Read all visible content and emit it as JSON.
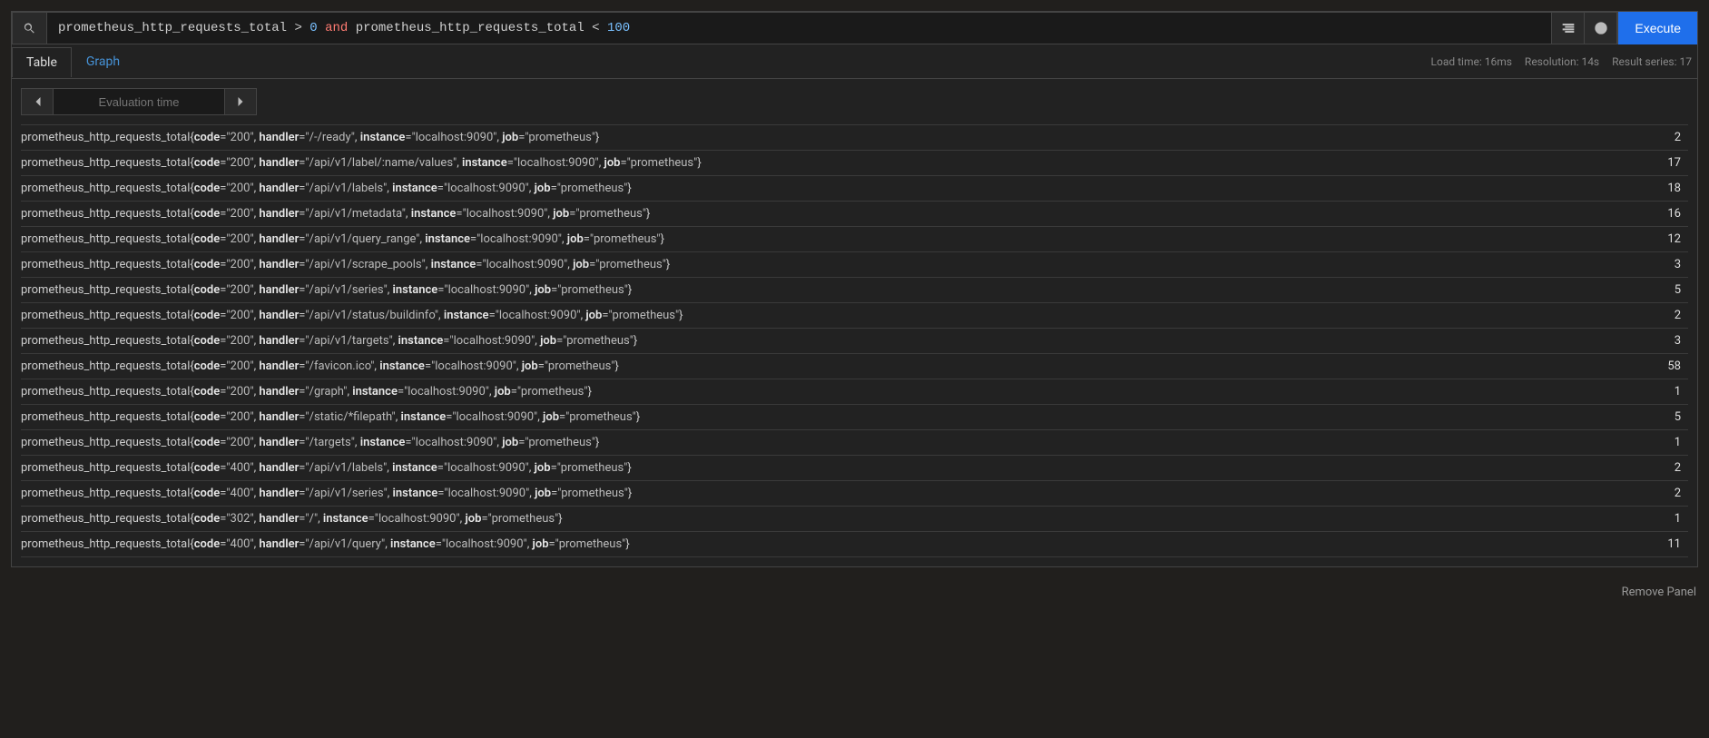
{
  "query": {
    "seg1": "prometheus_http_requests_total",
    "seg2": " > ",
    "seg3": "0",
    "seg4": " and ",
    "seg5": "prometheus_http_requests_total",
    "seg6": " < ",
    "seg7": "100"
  },
  "execute_label": "Execute",
  "tabs": {
    "table": "Table",
    "graph": "Graph"
  },
  "stats": {
    "load": "Load time: 16ms",
    "res": "Resolution: 14s",
    "series": "Result series: 17"
  },
  "eval_placeholder": "Evaluation time",
  "remove": "Remove Panel",
  "metric": "prometheus_http_requests_total",
  "labels": {
    "code": "code",
    "handler": "handler",
    "instance": "instance",
    "job": "job"
  },
  "instance_val": "localhost:9090",
  "job_val": "prometheus",
  "chart_data": {
    "type": "table",
    "rows": [
      {
        "code": "200",
        "handler": "/-/ready",
        "value": "2"
      },
      {
        "code": "200",
        "handler": "/api/v1/label/:name/values",
        "value": "17"
      },
      {
        "code": "200",
        "handler": "/api/v1/labels",
        "value": "18"
      },
      {
        "code": "200",
        "handler": "/api/v1/metadata",
        "value": "16"
      },
      {
        "code": "200",
        "handler": "/api/v1/query_range",
        "value": "12"
      },
      {
        "code": "200",
        "handler": "/api/v1/scrape_pools",
        "value": "3"
      },
      {
        "code": "200",
        "handler": "/api/v1/series",
        "value": "5"
      },
      {
        "code": "200",
        "handler": "/api/v1/status/buildinfo",
        "value": "2"
      },
      {
        "code": "200",
        "handler": "/api/v1/targets",
        "value": "3"
      },
      {
        "code": "200",
        "handler": "/favicon.ico",
        "value": "58"
      },
      {
        "code": "200",
        "handler": "/graph",
        "value": "1"
      },
      {
        "code": "200",
        "handler": "/static/*filepath",
        "value": "5"
      },
      {
        "code": "200",
        "handler": "/targets",
        "value": "1"
      },
      {
        "code": "400",
        "handler": "/api/v1/labels",
        "value": "2"
      },
      {
        "code": "400",
        "handler": "/api/v1/series",
        "value": "2"
      },
      {
        "code": "302",
        "handler": "/",
        "value": "1"
      },
      {
        "code": "400",
        "handler": "/api/v1/query",
        "value": "11"
      }
    ]
  }
}
